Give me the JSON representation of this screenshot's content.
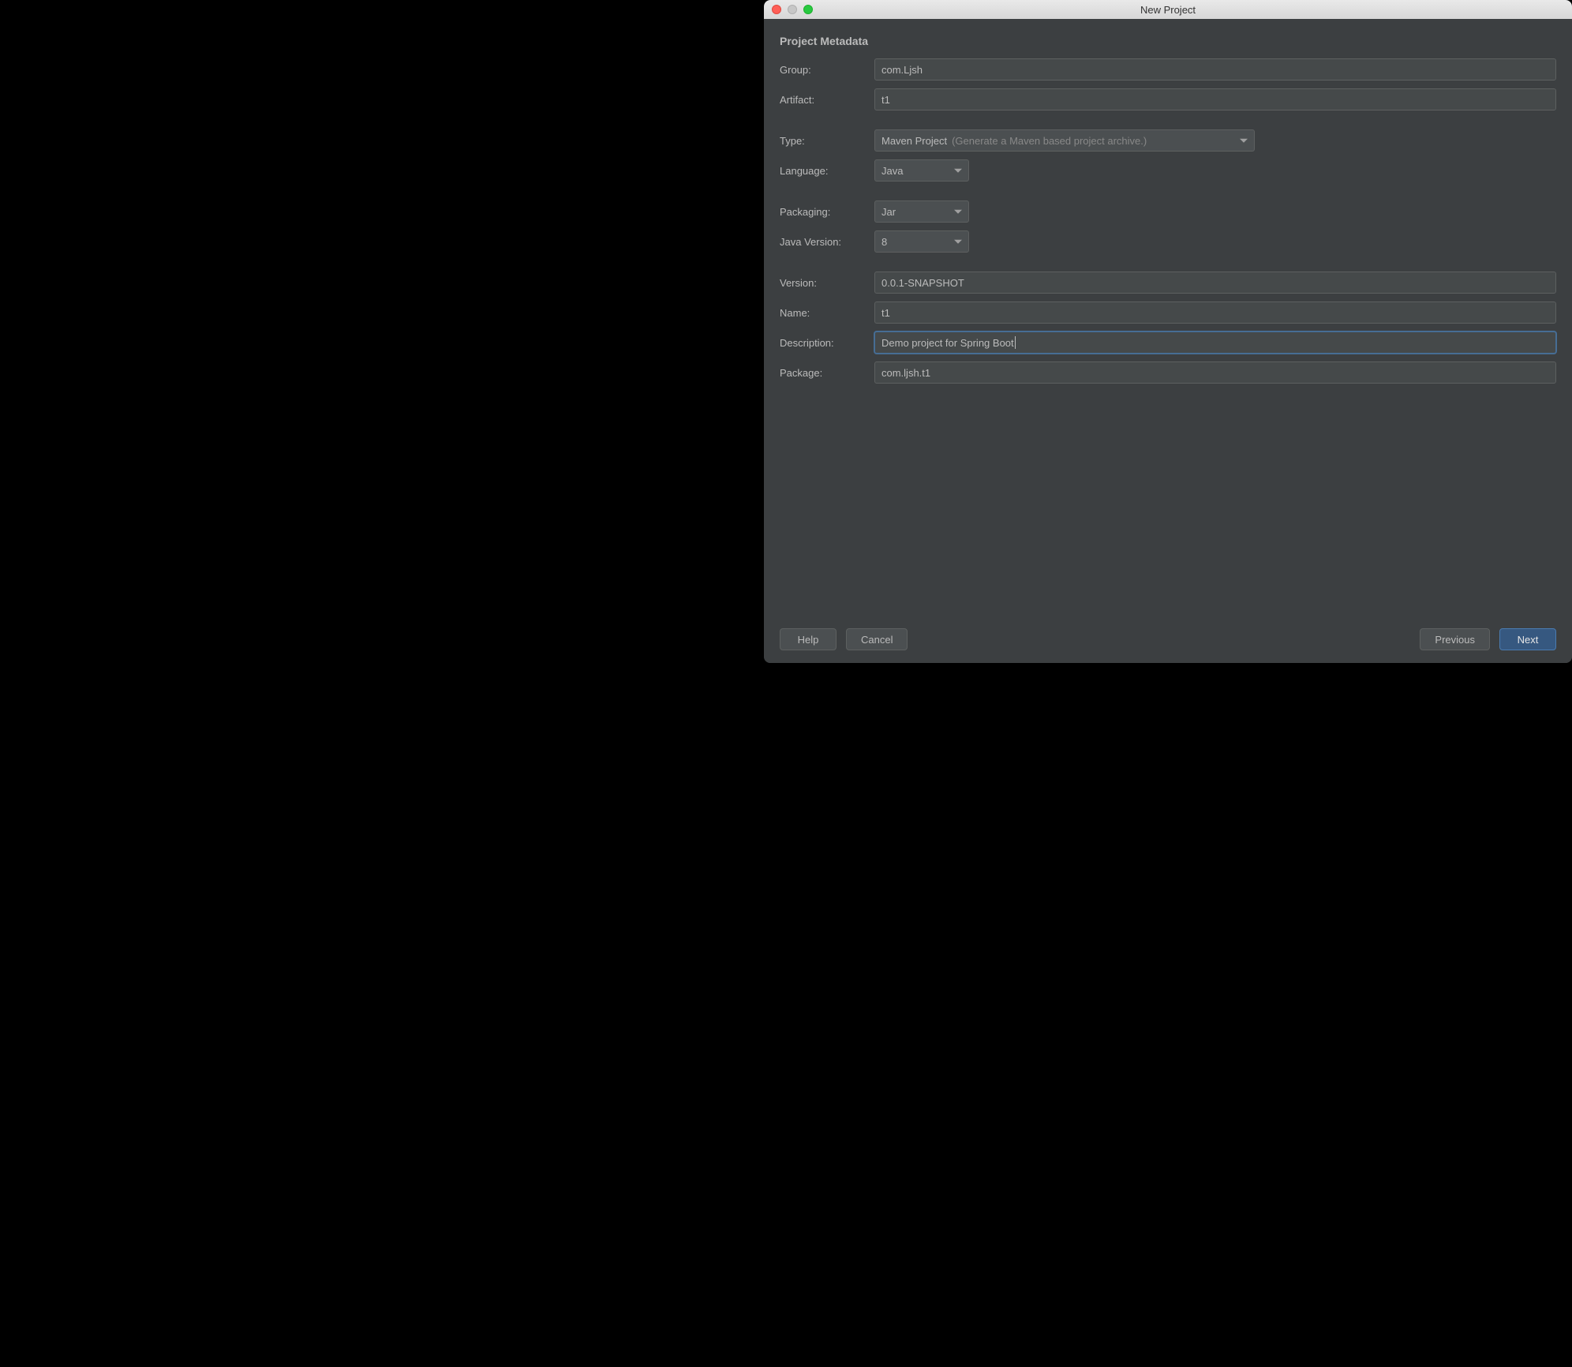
{
  "window": {
    "title": "New Project"
  },
  "section_title": "Project Metadata",
  "labels": {
    "group": "Group:",
    "artifact": "Artifact:",
    "type": "Type:",
    "language": "Language:",
    "packaging": "Packaging:",
    "java_version": "Java Version:",
    "version": "Version:",
    "name": "Name:",
    "description": "Description:",
    "package": "Package:"
  },
  "values": {
    "group": "com.Ljsh",
    "artifact": "t1",
    "type_main": "Maven Project",
    "type_hint": "(Generate a Maven based project archive.)",
    "language": "Java",
    "packaging": "Jar",
    "java_version": "8",
    "version": "0.0.1-SNAPSHOT",
    "name": "t1",
    "description": "Demo project for Spring Boot",
    "package": "com.ljsh.t1"
  },
  "buttons": {
    "help": "Help",
    "cancel": "Cancel",
    "previous": "Previous",
    "next": "Next"
  }
}
